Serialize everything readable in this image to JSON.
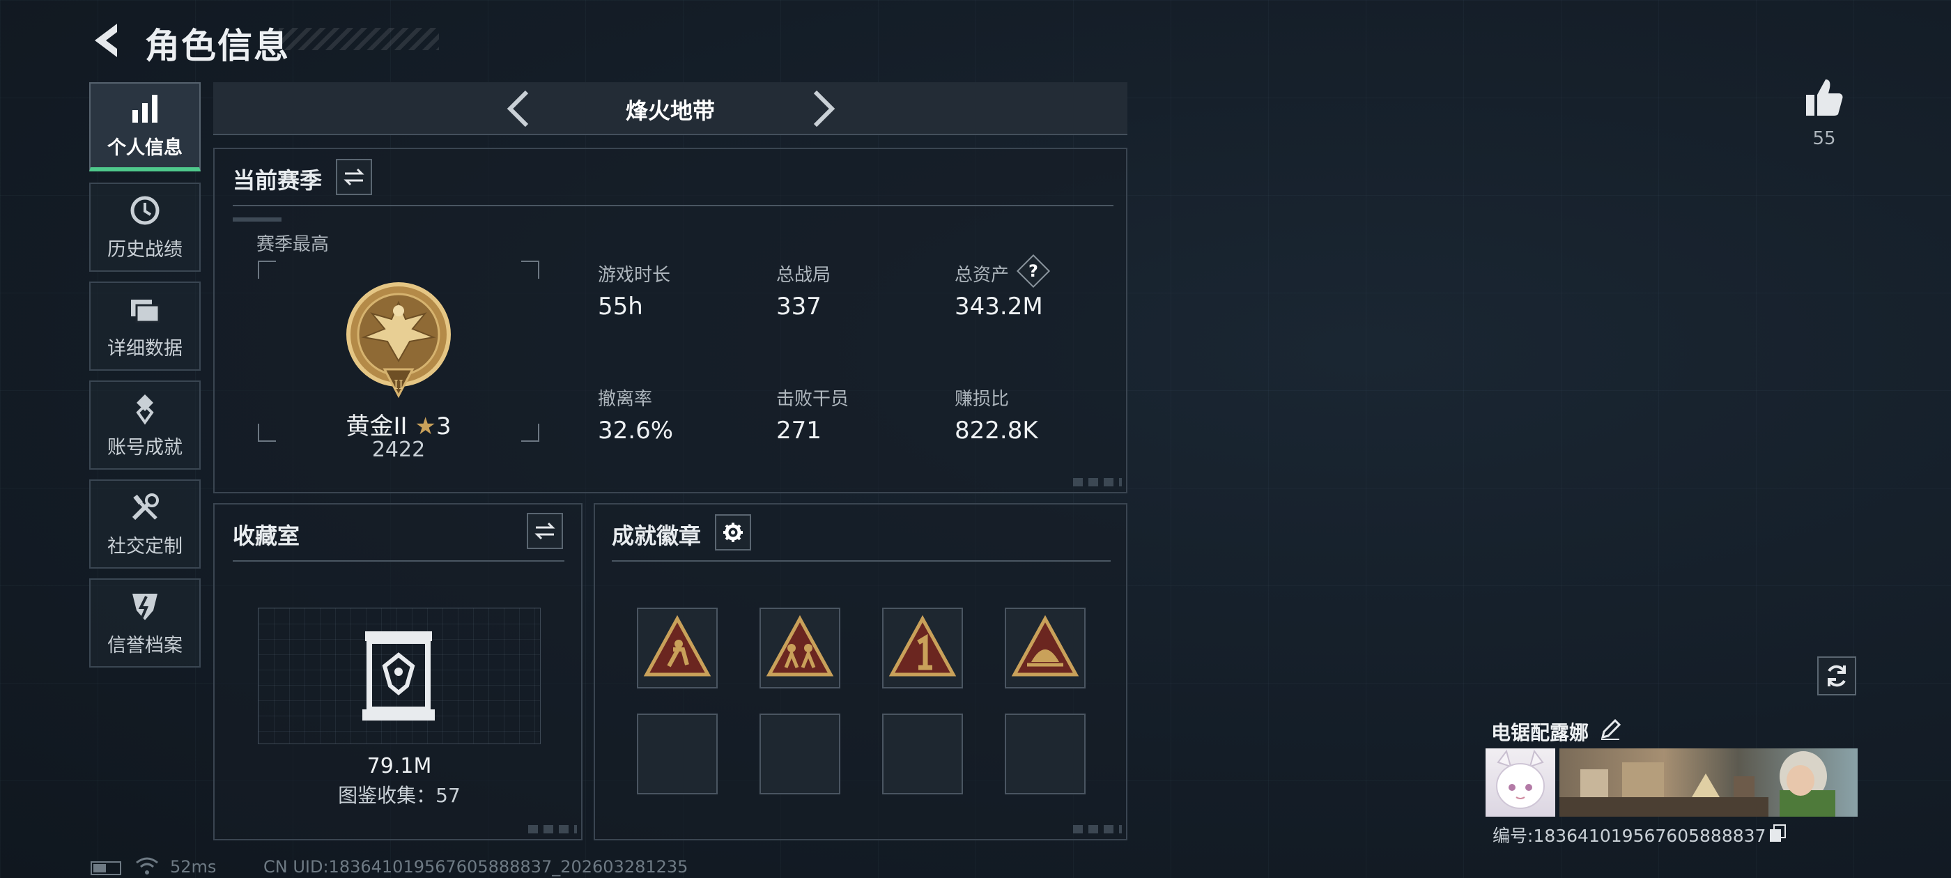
{
  "header": {
    "title": "角色信息"
  },
  "sidebar": {
    "items": [
      {
        "label": "个人信息",
        "icon": "bar-chart-icon",
        "active": true
      },
      {
        "label": "历史战绩",
        "icon": "history-clock-icon",
        "active": false
      },
      {
        "label": "详细数据",
        "icon": "folder-icon",
        "active": false
      },
      {
        "label": "账号成就",
        "icon": "medal-icon",
        "active": false
      },
      {
        "label": "社交定制",
        "icon": "tools-icon",
        "active": false
      },
      {
        "label": "信誉档案",
        "icon": "credit-shield-icon",
        "active": false
      }
    ]
  },
  "mode": {
    "name": "烽火地带"
  },
  "season": {
    "title": "当前赛季",
    "best_label": "赛季最高",
    "rank_name": "黄金II",
    "rank_stars": "3",
    "rank_points": "2422",
    "stats": [
      {
        "label": "游戏时长",
        "value": "55h"
      },
      {
        "label": "总战局",
        "value": "337"
      },
      {
        "label": "总资产",
        "value": "343.2M",
        "help": "?"
      },
      {
        "label": "撤离率",
        "value": "32.6%"
      },
      {
        "label": "击败干员",
        "value": "271"
      },
      {
        "label": "赚损比",
        "value": "822.8K"
      }
    ]
  },
  "collection": {
    "title": "收藏室",
    "value": "79.1M",
    "count_text": "图鉴收集：57"
  },
  "achievements": {
    "title": "成就徽章",
    "badges": [
      "badge-runner-icon",
      "badge-team-icon",
      "badge-first-icon",
      "badge-helmet-icon"
    ],
    "empty_slots": 4
  },
  "likes": {
    "count": "55"
  },
  "profile": {
    "name": "电锯配露娜",
    "id_text": "编号:183641019567605888837"
  },
  "footer": {
    "ping": "52ms",
    "uid": "CN UID:183641019567605888837_202603281235"
  },
  "colors": {
    "accent": "#4fc98c",
    "gold": "#c9a15a",
    "badge_bg": "#6b2620"
  }
}
